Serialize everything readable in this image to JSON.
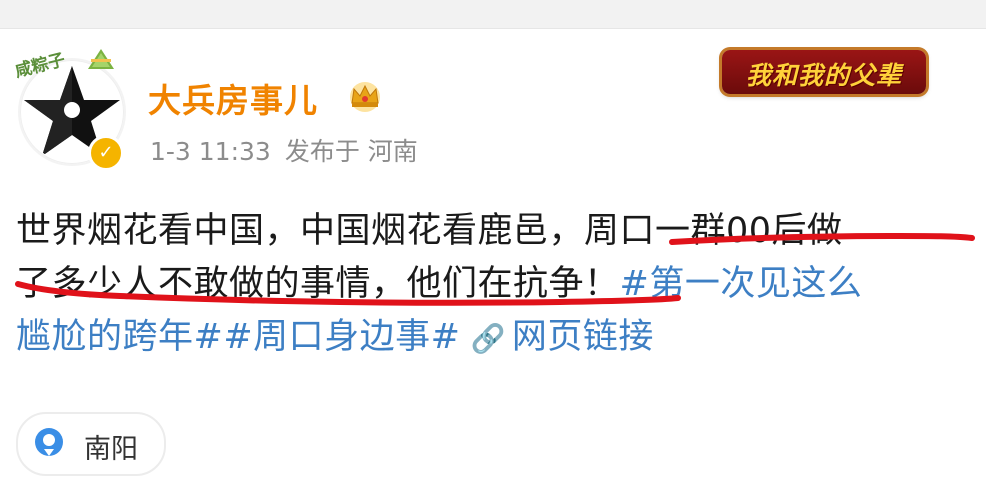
{
  "post": {
    "pendant": "咸粽子",
    "username": "大兵房事儿",
    "time": "1-3 11:33",
    "source": "发布于 河南",
    "badge": "我和我的父辈",
    "body": {
      "line1": "世界烟花看中国，中国烟花看鹿邑，周口一群00后做",
      "line2_text": "了多少人不敢做的事情，他们在抗争！",
      "line2_tag": "#第一次见这么",
      "line3_tag": "尴尬的跨年##周口身边事#",
      "link_icon": "🔗",
      "link_text": "网页链接"
    },
    "location": "南阳"
  },
  "colors": {
    "username": "#f08300",
    "tag": "#3d7fc4",
    "underline": "#e0121a",
    "verified": "#f5b400",
    "pin": "#3a8ee6"
  },
  "icons": {
    "avatar": "black-star-avatar",
    "pendant": "zongzi-icon",
    "crown": "crown-icon",
    "verified": "verified-icon",
    "link": "link-icon",
    "location": "location-pin-icon"
  }
}
